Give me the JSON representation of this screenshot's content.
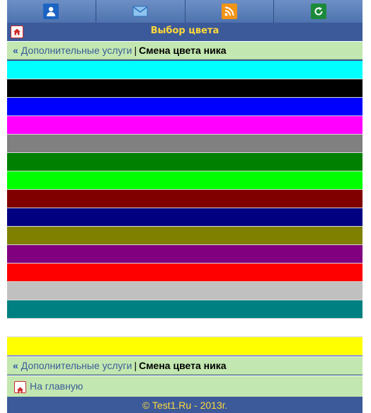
{
  "nav": {
    "icons": [
      "profile-icon",
      "mail-icon",
      "rss-icon",
      "refresh-icon"
    ]
  },
  "header": {
    "title": "Выбор цвета"
  },
  "breadcrumb": {
    "back_symbol": "«",
    "parent_label": "Дополнительные услуги",
    "separator": "|",
    "current_label": "Смена цвета ника"
  },
  "colors": [
    "#00ffff",
    "#000000",
    "#0000ff",
    "#ff00ff",
    "#808080",
    "#008000",
    "#00ff00",
    "#800000",
    "#000080",
    "#808000",
    "#800080",
    "#ff0000",
    "#c0c0c0",
    "#008080",
    "#ffffff",
    "#ffff00"
  ],
  "home_link": {
    "label": "На главную"
  },
  "footer": {
    "text": "© Test1.Ru - 2013г."
  },
  "theme": {
    "bar": "#3c5a9a",
    "accent": "#ffd83a",
    "crumb_bg": "#c3e7b0"
  }
}
